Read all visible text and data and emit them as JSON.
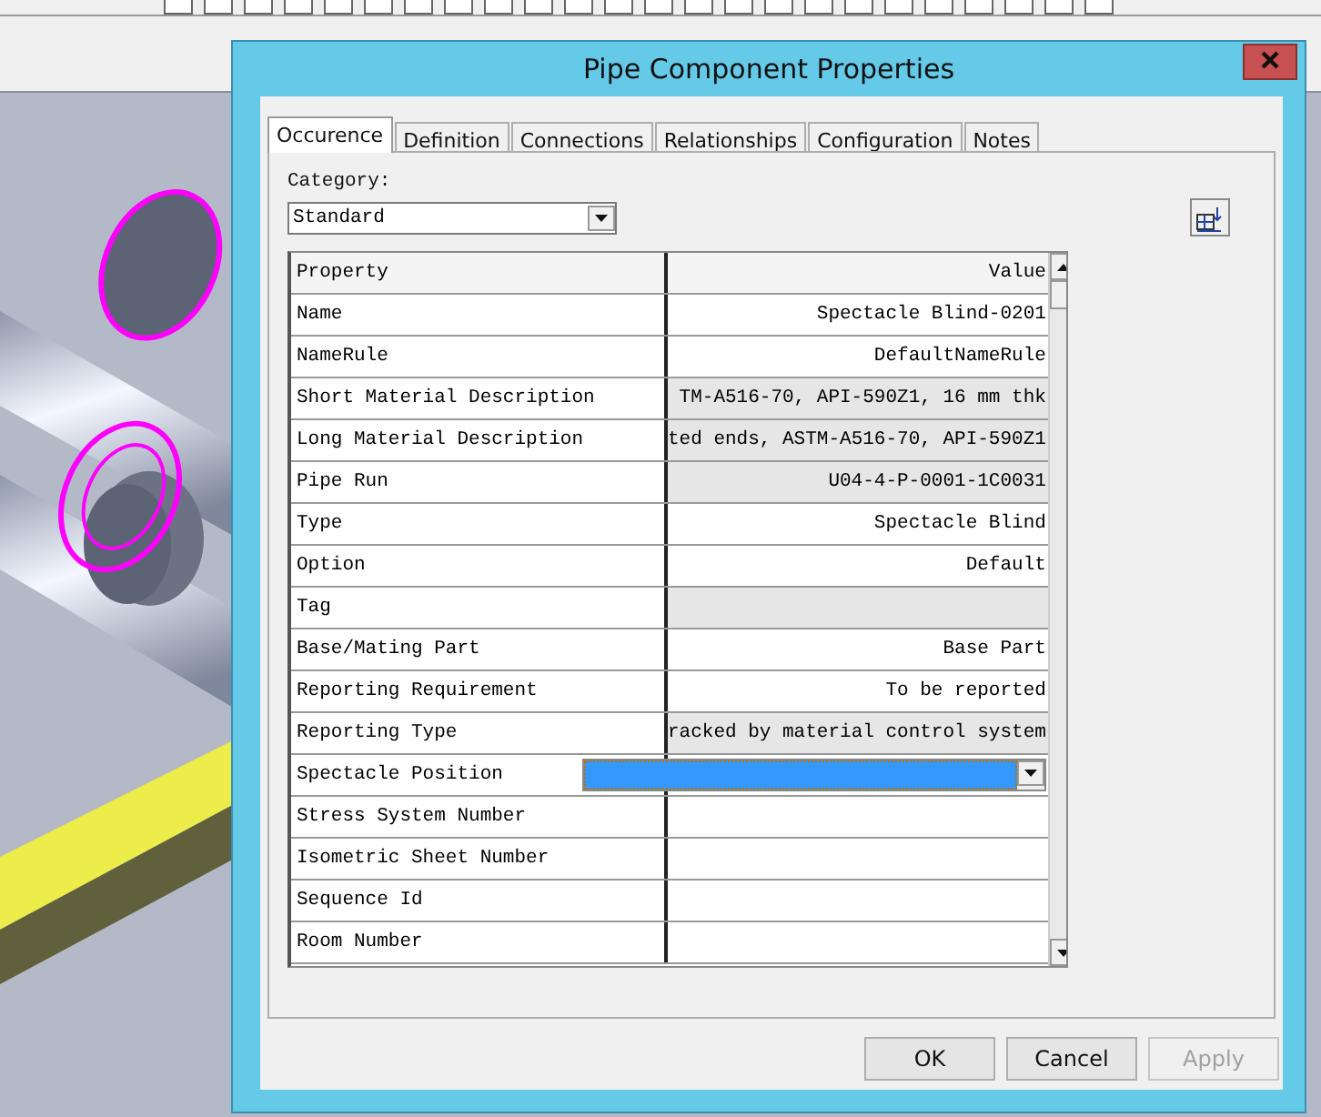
{
  "window": {
    "title": "Pipe Component Properties"
  },
  "tabs": [
    {
      "label": "Occurence",
      "selected": true
    },
    {
      "label": "Definition",
      "selected": false
    },
    {
      "label": "Connections",
      "selected": false
    },
    {
      "label": "Relationships",
      "selected": false
    },
    {
      "label": "Configuration",
      "selected": false
    },
    {
      "label": "Notes",
      "selected": false
    }
  ],
  "category": {
    "label": "Category:",
    "value": "Standard"
  },
  "grid": {
    "columns": [
      "Property",
      "Value"
    ],
    "rows": [
      {
        "kind": "text",
        "property": "Name",
        "value": "Spectacle Blind-0201",
        "readonly": false
      },
      {
        "kind": "text",
        "property": "NameRule",
        "value": "DefaultNameRule",
        "readonly": false
      },
      {
        "kind": "text",
        "property": "Short Material Description",
        "value": "TM-A516-70, API-590Z1, 16 mm thk",
        "readonly": true
      },
      {
        "kind": "text",
        "property": "Long Material Description",
        "value": "ted ends, ASTM-A516-70, API-590Z1",
        "readonly": true
      },
      {
        "kind": "text",
        "property": "Pipe Run",
        "value": "U04-4-P-0001-1C0031",
        "readonly": true
      },
      {
        "kind": "text",
        "property": "Type",
        "value": "Spectacle Blind",
        "readonly": false
      },
      {
        "kind": "text",
        "property": "Option",
        "value": "Default",
        "readonly": false
      },
      {
        "kind": "text",
        "property": "Tag",
        "readonly": true
      },
      {
        "kind": "text",
        "property": "Base/Mating Part",
        "value": "Base Part",
        "readonly": false
      },
      {
        "kind": "text",
        "property": "Reporting Requirement",
        "value": "To be reported",
        "readonly": false
      },
      {
        "kind": "text",
        "property": "Reporting Type",
        "value": "racked by material control system",
        "readonly": true
      },
      {
        "kind": "combo",
        "property": "Spectacle Position",
        "readonly": false
      },
      {
        "kind": "text",
        "property": "Stress System Number",
        "readonly": false
      },
      {
        "kind": "text",
        "property": "Isometric Sheet Number",
        "readonly": false
      },
      {
        "kind": "text",
        "property": "Sequence Id",
        "readonly": false
      },
      {
        "kind": "text",
        "property": "Room Number",
        "readonly": false
      }
    ]
  },
  "buttons": [
    {
      "label": "OK",
      "disabled": false
    },
    {
      "label": "Cancel",
      "disabled": false
    },
    {
      "label": "Apply",
      "disabled": true
    }
  ]
}
